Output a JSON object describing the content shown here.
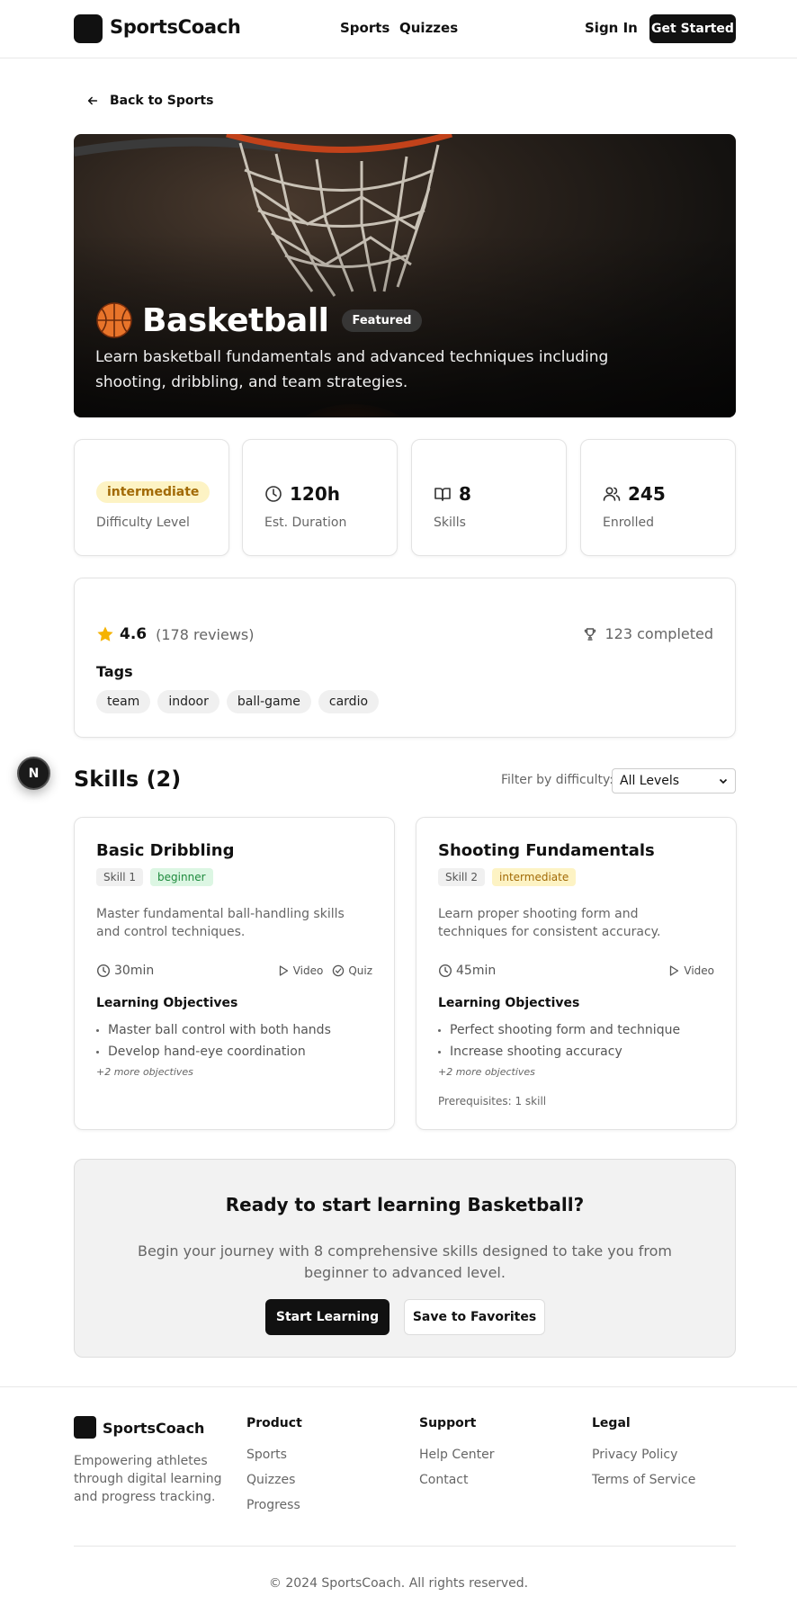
{
  "header": {
    "brand": "SportsCoach",
    "nav": [
      "Sports",
      "Quizzes"
    ],
    "sign_in": "Sign In",
    "get_started": "Get Started"
  },
  "back_link": "Back to Sports",
  "hero": {
    "emoji": "🏀",
    "title": "Basketball",
    "badge": "Featured",
    "description": "Learn basketball fundamentals and advanced techniques including shooting, dribbling, and team strategies."
  },
  "stats": {
    "difficulty": {
      "value": "intermediate",
      "label": "Difficulty Level"
    },
    "duration": {
      "value": "120h",
      "label": "Est. Duration",
      "icon": "clock-icon"
    },
    "skills": {
      "value": "8",
      "label": "Skills",
      "icon": "book-icon"
    },
    "enrolled": {
      "value": "245",
      "label": "Enrolled",
      "icon": "users-icon"
    }
  },
  "rating": {
    "score": "4.6",
    "reviews": "(178 reviews)",
    "completed": "123 completed",
    "tags_title": "Tags",
    "tags": [
      "team",
      "indoor",
      "ball-game",
      "cardio"
    ]
  },
  "fab_label": "N",
  "skills_section": {
    "title": "Skills (2)",
    "filter_label": "Filter by difficulty:",
    "filter_value": "All Levels"
  },
  "skills": [
    {
      "title": "Basic Dribbling",
      "number": "Skill 1",
      "level": "beginner",
      "description": "Master fundamental ball-handling skills and control techniques.",
      "duration": "30min",
      "video": "Video",
      "quiz": "Quiz",
      "objectives_title": "Learning Objectives",
      "objectives": [
        "Master ball control with both hands",
        "Develop hand-eye coordination"
      ],
      "more": "+2 more objectives"
    },
    {
      "title": "Shooting Fundamentals",
      "number": "Skill 2",
      "level": "intermediate",
      "description": "Learn proper shooting form and techniques for consistent accuracy.",
      "duration": "45min",
      "video": "Video",
      "objectives_title": "Learning Objectives",
      "objectives": [
        "Perfect shooting form and technique",
        "Increase shooting accuracy"
      ],
      "more": "+2 more objectives",
      "prerequisites": "Prerequisites: 1 skill"
    }
  ],
  "cta": {
    "title": "Ready to start learning Basketball?",
    "description": "Begin your journey with 8 comprehensive skills designed to take you from beginner to advanced level.",
    "primary": "Start Learning",
    "secondary": "Save to Favorites"
  },
  "footer": {
    "brand": "SportsCoach",
    "tagline": "Empowering athletes through digital learning and progress tracking.",
    "product_title": "Product",
    "product_links": [
      "Sports",
      "Quizzes",
      "Progress"
    ],
    "support_title": "Support",
    "support_links": [
      "Help Center",
      "Contact"
    ],
    "legal_title": "Legal",
    "legal_links": [
      "Privacy Policy",
      "Terms of Service"
    ],
    "copyright": "© 2024 SportsCoach. All rights reserved."
  },
  "colors": {
    "primary": "#111111",
    "muted_text": "#666666",
    "intermediate_bg": "#fdf3c4",
    "intermediate_text": "#a26a06",
    "beginner_bg": "#dcf6e3",
    "beginner_text": "#1e8a3d",
    "star": "#f5b301"
  }
}
